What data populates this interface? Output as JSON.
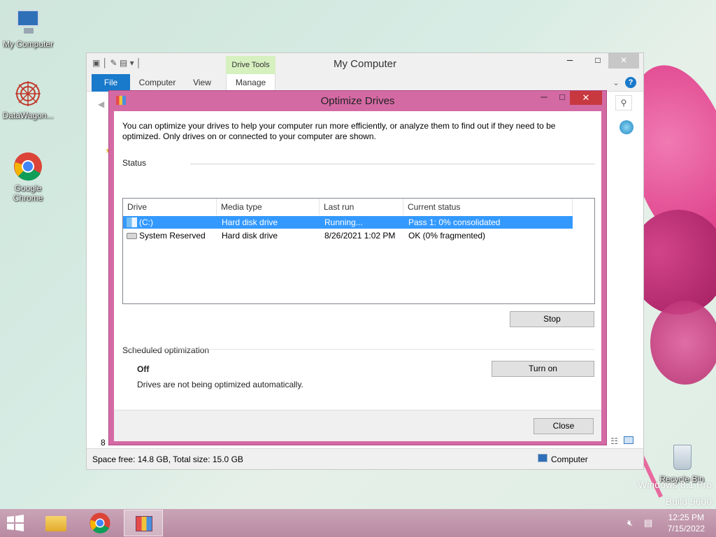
{
  "desktop": {
    "icons": [
      {
        "label": "My Computer",
        "icon": "computer-icon"
      },
      {
        "label": "DataWagon...",
        "icon": "datawagon-icon"
      },
      {
        "label": "Google Chrome",
        "icon": "chrome-icon"
      },
      {
        "label": "Recycle Bin",
        "icon": "recycle-bin-icon"
      }
    ],
    "watermark_line1": "Windows 8.1 Pro",
    "watermark_line2": "Build 9600"
  },
  "explorer": {
    "title": "My Computer",
    "contextual_tab": "Drive Tools",
    "tabs": [
      "File",
      "Computer",
      "View",
      "Manage"
    ],
    "status_left": "Space free: 14.8 GB, Total size: 15.0 GB",
    "status_right": "Computer",
    "items_count": "8"
  },
  "dialog": {
    "title": "Optimize Drives",
    "description": "You can optimize your drives to help your computer run more efficiently, or analyze them to find out if they need to be optimized. Only drives on or connected to your computer are shown.",
    "status_heading": "Status",
    "columns": [
      "Drive",
      "Media type",
      "Last run",
      "Current status"
    ],
    "drives": [
      {
        "drive": "(C:)",
        "media": "Hard disk drive",
        "last_run": "Running...",
        "status": "Pass 1: 0% consolidated"
      },
      {
        "drive": "System Reserved",
        "media": "Hard disk drive",
        "last_run": "8/26/2021 1:02 PM",
        "status": "OK (0% fragmented)"
      }
    ],
    "stop_label": "Stop",
    "scheduled_heading": "Scheduled optimization",
    "schedule_state": "Off",
    "schedule_desc": "Drives are not being optimized automatically.",
    "turn_on_label": "Turn on",
    "close_label": "Close"
  },
  "taskbar": {
    "time": "12:25 PM",
    "date": "7/15/2022"
  },
  "colors": {
    "accent": "#1979ca",
    "selection": "#3399ff",
    "dialog_frame": "#d46aa4",
    "close_red": "#c7383f"
  }
}
